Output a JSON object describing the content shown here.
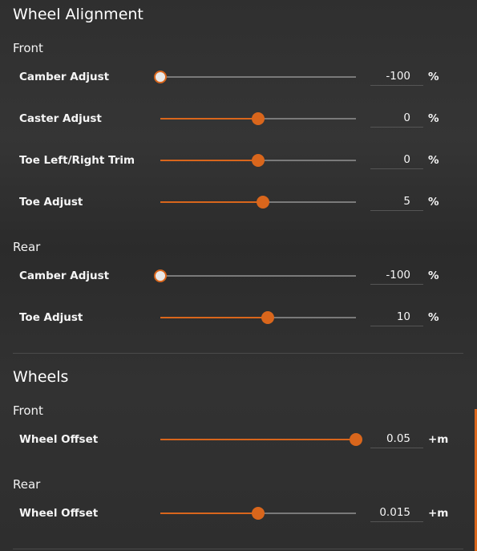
{
  "accent_color": "#d9661c",
  "wheel_alignment": {
    "title": "Wheel Alignment",
    "front": {
      "title": "Front",
      "rows": [
        {
          "label": "Camber Adjust",
          "value": "-100",
          "unit": "%",
          "level": 0
        },
        {
          "label": "Caster Adjust",
          "value": "0",
          "unit": "%",
          "level": 0.5
        },
        {
          "label": "Toe Left/Right Trim",
          "value": "0",
          "unit": "%",
          "level": 0.5
        },
        {
          "label": "Toe Adjust",
          "value": "5",
          "unit": "%",
          "level": 0.525
        }
      ]
    },
    "rear": {
      "title": "Rear",
      "rows": [
        {
          "label": "Camber Adjust",
          "value": "-100",
          "unit": "%",
          "level": 0
        },
        {
          "label": "Toe Adjust",
          "value": "10",
          "unit": "%",
          "level": 0.55
        }
      ]
    }
  },
  "wheels": {
    "title": "Wheels",
    "front": {
      "title": "Front",
      "rows": [
        {
          "label": "Wheel Offset",
          "value": "0.05",
          "unit": "+m",
          "level": 1
        }
      ]
    },
    "rear": {
      "title": "Rear",
      "rows": [
        {
          "label": "Wheel Offset",
          "value": "0.015",
          "unit": "+m",
          "level": 0.5
        }
      ]
    }
  }
}
